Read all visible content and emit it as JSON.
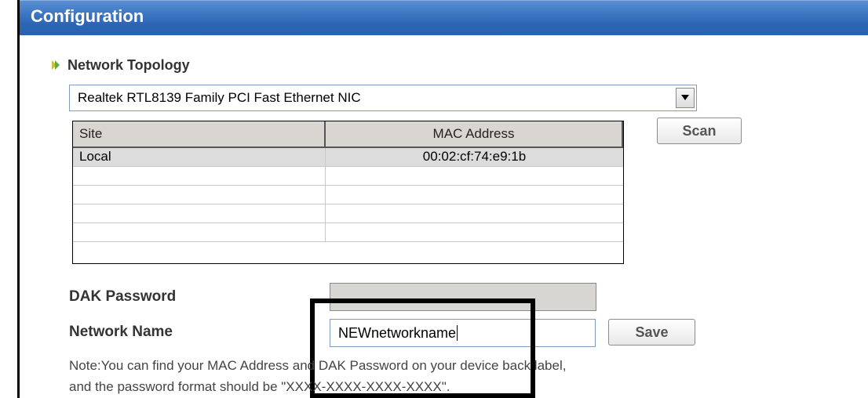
{
  "title": "Configuration",
  "section": {
    "title": "Network Topology",
    "icon": "bullet-arrow-icon"
  },
  "adapter_select": {
    "value": "Realtek RTL8139 Family PCI Fast Ethernet NIC"
  },
  "devices_table": {
    "headers": {
      "site": "Site",
      "mac": "MAC Address"
    },
    "rows": [
      {
        "site": "Local",
        "mac": "00:02:cf:74:e9:1b"
      },
      {
        "site": "",
        "mac": ""
      },
      {
        "site": "",
        "mac": ""
      },
      {
        "site": "",
        "mac": ""
      },
      {
        "site": "",
        "mac": ""
      }
    ]
  },
  "scan_button": {
    "label": "Scan"
  },
  "dak_password": {
    "label": "DAK Password",
    "value": ""
  },
  "network_name": {
    "label": "Network Name",
    "value": "NEWnetworkname"
  },
  "save_button": {
    "label": "Save"
  },
  "note": {
    "line1": "Note:You can find your MAC Address and DAK Password on your device back label,",
    "line2": "and the password format should be \"XXXX-XXXX-XXXX-XXXX\"."
  },
  "colors": {
    "titlebar": "#3f79c4",
    "highlight_box": "#000000"
  }
}
